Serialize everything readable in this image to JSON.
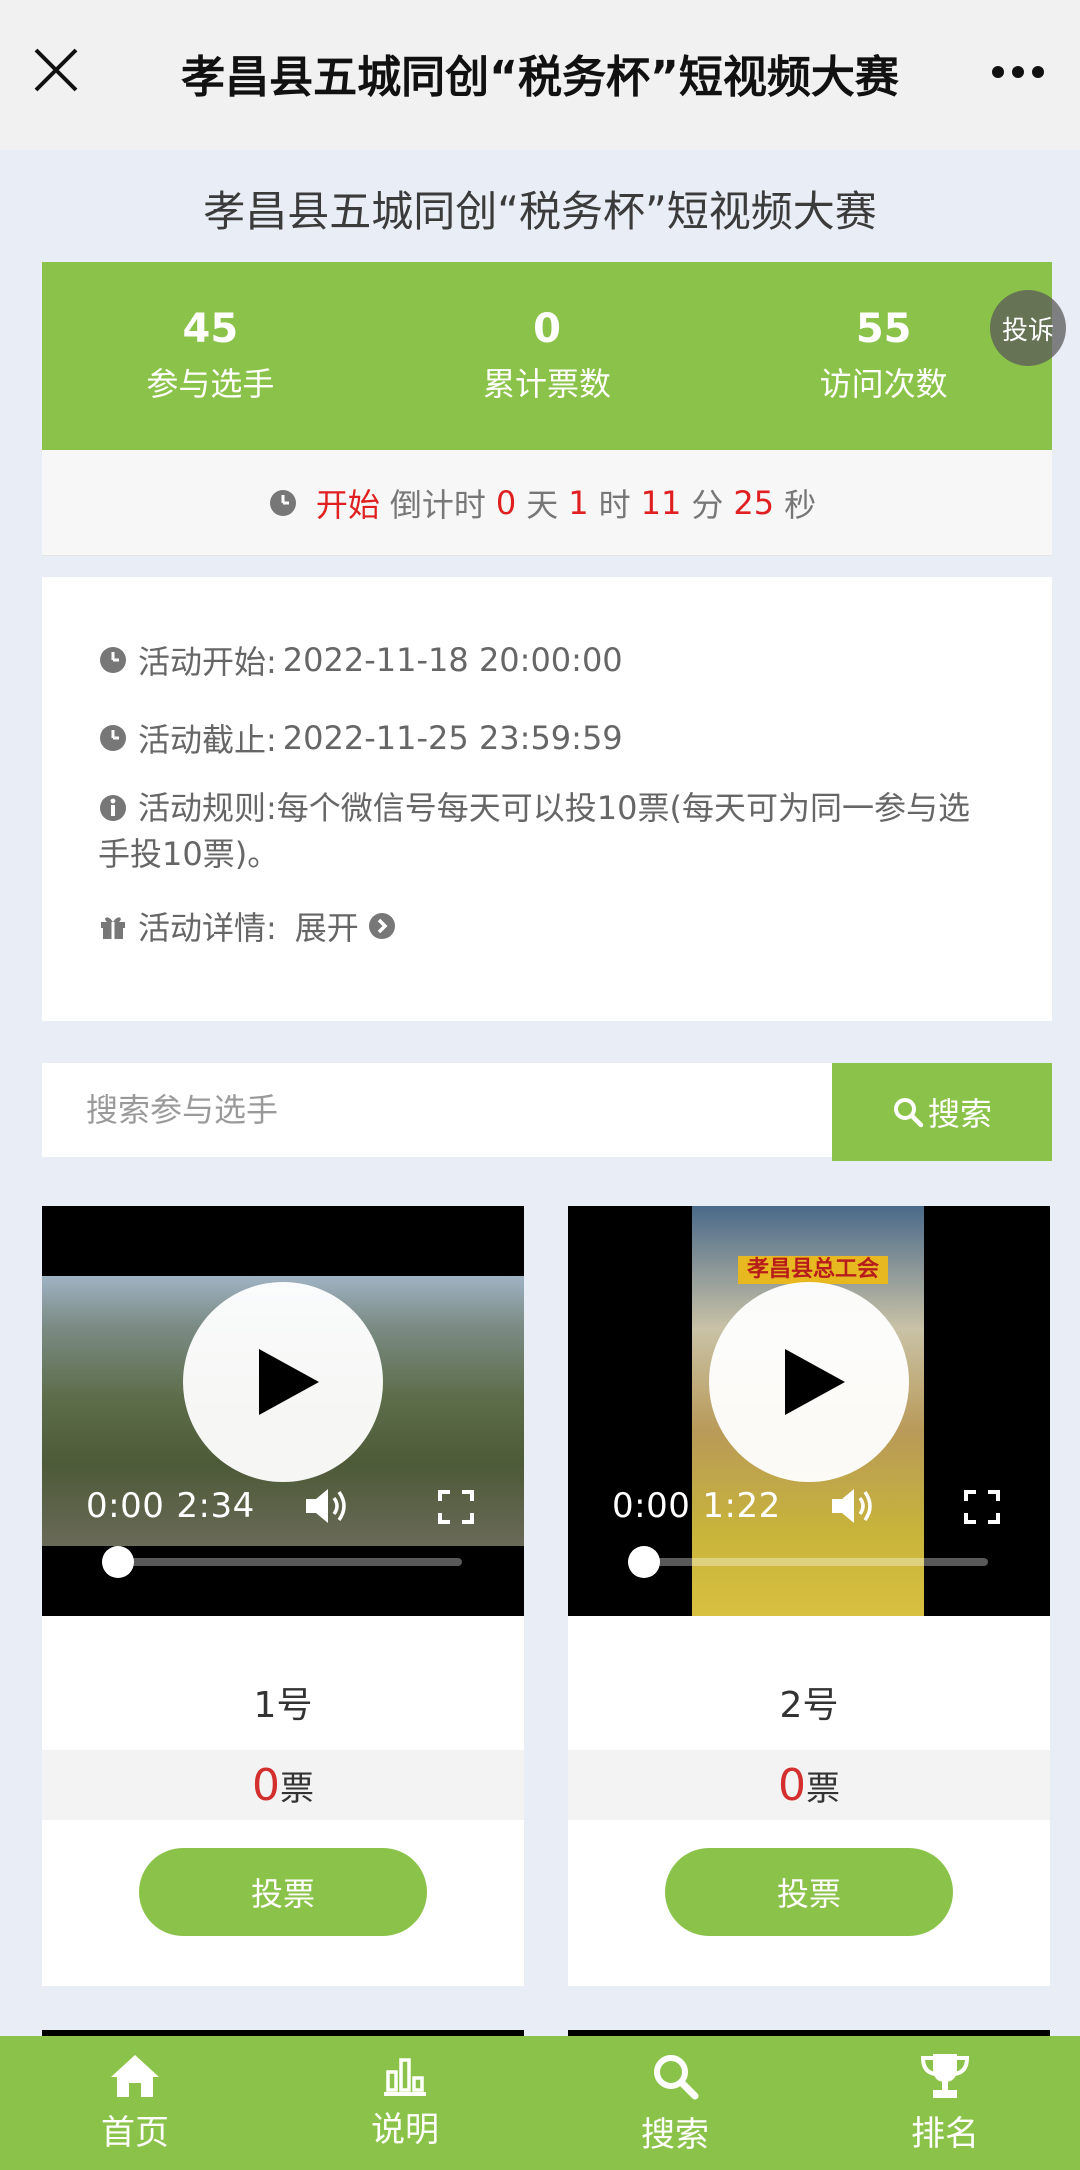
{
  "topbar": {
    "title": "孝昌县五城同创“税务杯”短视频大赛"
  },
  "page_title": "孝昌县五城同创“税务杯”短视频大赛",
  "stats": [
    {
      "num": "45",
      "label": "参与选手"
    },
    {
      "num": "0",
      "label": "累计票数"
    },
    {
      "num": "55",
      "label": "访问次数"
    }
  ],
  "complaint_label": "投诉",
  "countdown": {
    "status": "开始",
    "prefix": "倒计时",
    "days": "0",
    "days_unit": "天",
    "hours": "1",
    "hours_unit": "时",
    "minutes": "11",
    "minutes_unit": "分",
    "seconds": "25",
    "seconds_unit": "秒"
  },
  "info": {
    "start_label": "活动开始:",
    "start_value": "2022-11-18 20:00:00",
    "end_label": "活动截止:",
    "end_value": "2022-11-25 23:59:59",
    "rule_label": "活动规则:",
    "rule_value": "每个微信号每天可以投10票(每天可为同一参与选手投10票)。",
    "detail_label": "活动详情:",
    "detail_action": "展开"
  },
  "search": {
    "placeholder": "搜索参与选手",
    "button": "搜索"
  },
  "entries": [
    {
      "name": "1号",
      "votes": "0",
      "votes_unit": "票",
      "current_time": "0:00",
      "duration": "2:34",
      "vote_button": "投票",
      "progress": 0
    },
    {
      "name": "2号",
      "votes": "0",
      "votes_unit": "票",
      "current_time": "0:00",
      "duration": "1:22",
      "vote_button": "投票",
      "progress": 0,
      "banner": "孝昌县总工会"
    }
  ],
  "tabbar": [
    {
      "label": "首页",
      "icon": "home-icon"
    },
    {
      "label": "说明",
      "icon": "bar-chart-icon"
    },
    {
      "label": "搜索",
      "icon": "search-icon"
    },
    {
      "label": "排名",
      "icon": "trophy-icon"
    }
  ],
  "colors": {
    "accent": "#8bc34a",
    "countdown_red": "#e02020",
    "vote_red": "#d32f2f"
  }
}
